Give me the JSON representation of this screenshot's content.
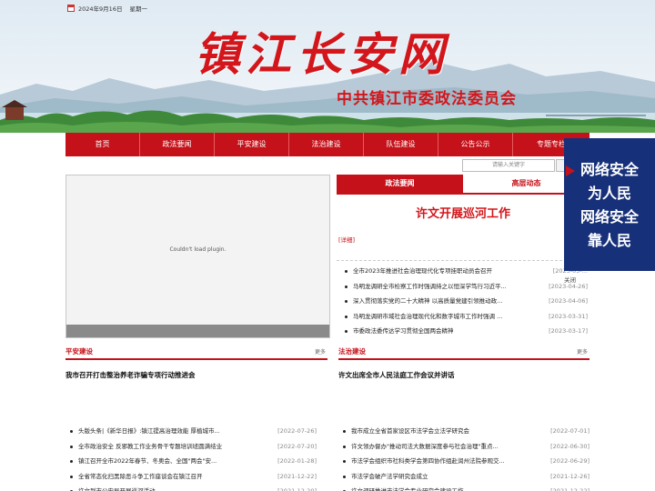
{
  "header": {
    "date": "2024年9月16日",
    "weekday": "星期一",
    "logo_text": "镇江长安网",
    "subtitle": "中共镇江市委政法委员会"
  },
  "nav": {
    "items": [
      "首页",
      "政法要闻",
      "平安建设",
      "法治建设",
      "队伍建设",
      "公告公示",
      "专题专栏"
    ]
  },
  "search": {
    "placeholder": "请输入关键字"
  },
  "plugin": {
    "message": "Couldn't load plugin."
  },
  "tabs": {
    "active": "政法要闻",
    "inactive": "高层动态"
  },
  "headline": {
    "title": "许文开展巡河工作",
    "detail_link": "[详细]"
  },
  "right_news": [
    {
      "title": "全市2023年推进社会治理现代化专项挂职动员会召开",
      "date": "[2023-05-..."
    },
    {
      "title": "马明龙调研全市检察工作时强调持之以恒深学笃行习近平...",
      "date": "[2023-04-26]"
    },
    {
      "title": "深入贯彻落实党的二十大精神 以高质量党建引领推动政...",
      "date": "[2023-04-06]"
    },
    {
      "title": "马明龙调研市域社会治理现代化和数字城市工作时强调 ...",
      "date": "[2023-03-31]"
    },
    {
      "title": "市委政法委传达学习贯彻全国两会精神",
      "date": "[2023-03-17]"
    }
  ],
  "ping_an": {
    "title": "平安建设",
    "more": "更多",
    "featured": "我市召开打击整治养老诈骗专项行动推进会",
    "news": [
      {
        "title": "头版头条|《新华日报》:镇江提高治理效能 厚植城市...",
        "date": "[2022-07-26]"
      },
      {
        "title": "全市政治安全 反邪教工作业务骨干专题培训班圆满结业",
        "date": "[2022-07-20]"
      },
      {
        "title": "镇江召开全市2022年春节、冬奥会、全国\"两会\"安...",
        "date": "[2022-01-28]"
      },
      {
        "title": "全省常态化扫黑除恶斗争工作座谈会在镇江召开",
        "date": "[2021-12-22]"
      },
      {
        "title": "许文到市公安局开展巡河活动",
        "date": "[2021-12-20]"
      }
    ]
  },
  "fa_zhi": {
    "title": "法治建设",
    "more": "更多",
    "featured": "许文出席全市人民法庭工作会议并讲话",
    "news": [
      {
        "title": "我市成立全省首家设区市法学会立法学研究会",
        "date": "[2022-07-01]"
      },
      {
        "title": "许文领办督办\"推动司法大数据深度参与社会治理\"重点...",
        "date": "[2022-06-30]"
      },
      {
        "title": "市法学会组织市社科类学会第四协作组赴润州法院参观交...",
        "date": "[2022-06-29]"
      },
      {
        "title": "市法学会破产法学研究会成立",
        "date": "[2021-12-26]"
      },
      {
        "title": "许文调研推进市法学会专业研究会建设工作",
        "date": "[2021-12-22]"
      }
    ]
  },
  "float_ad": {
    "lines": [
      "网络安全",
      "为人民",
      "网络安全",
      "靠人民"
    ],
    "close": "关闭"
  },
  "colors": {
    "brand_red": "#c5121a",
    "ad_blue": "#17307a"
  }
}
